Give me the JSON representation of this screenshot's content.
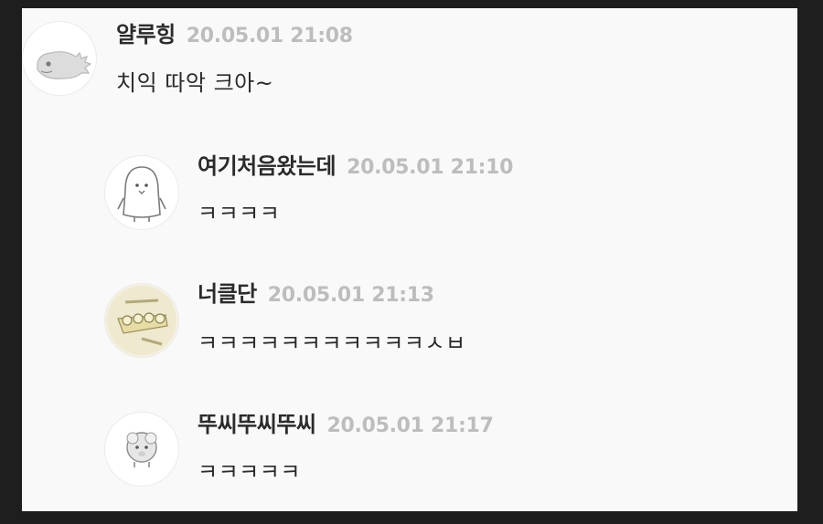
{
  "comments": [
    {
      "nickname": "얄루힝",
      "date": "20.05.01 21:08",
      "text": "치익 따악 크아~",
      "avatar_icon": "dinosaur-icon"
    },
    {
      "nickname": "여기처음왔는데",
      "date": "20.05.01 21:10",
      "text": "ㅋㅋㅋㅋ",
      "avatar_icon": "penguin-icon"
    },
    {
      "nickname": "너클단",
      "date": "20.05.01 21:13",
      "text": "ㅋㅋㅋㅋㅋㅋㅋㅋㅋㅋㅋㅅㅂ",
      "avatar_icon": "brass-knuckles-icon"
    },
    {
      "nickname": "뚜씨뚜씨뚜씨",
      "date": "20.05.01 21:17",
      "text": "ㅋㅋㅋㅋㅋ",
      "avatar_icon": "sheep-icon"
    }
  ],
  "colors": {
    "background": "#1e1e1e",
    "panel": "#f9f9f9",
    "text": "#2b2b2b",
    "date": "#bdbdbd"
  }
}
